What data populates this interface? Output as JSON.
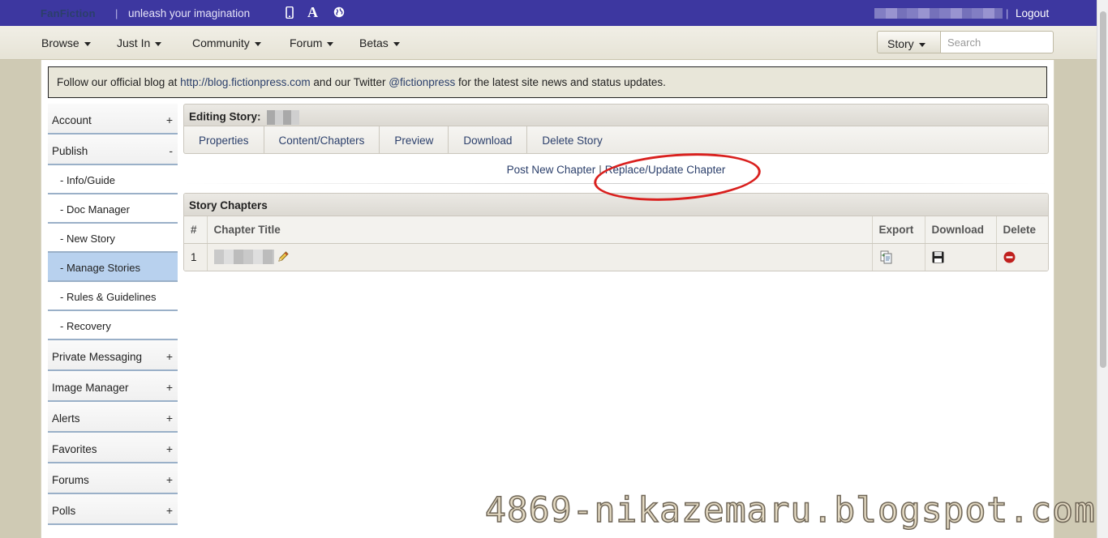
{
  "topbar": {
    "brand": "FanFiction",
    "separator": "|",
    "tagline": "unleash your imagination",
    "logout": "Logout"
  },
  "nav": {
    "items": [
      "Browse",
      "Just In",
      "Community",
      "Forum",
      "Betas"
    ],
    "story_select": "Story",
    "search_placeholder": "Search"
  },
  "notice": {
    "text_1": "Follow our official blog at ",
    "blog_link": "http://blog.fictionpress.com",
    "text_2": " and our Twitter ",
    "twitter_link": "@fictionpress",
    "text_3": " for the latest site news and status updates."
  },
  "sidebar": {
    "account": "Account",
    "publish": "Publish",
    "publish_items": [
      "- Info/Guide",
      "- Doc Manager",
      "- New Story",
      "- Manage Stories",
      "- Rules & Guidelines",
      "- Recovery"
    ],
    "more": [
      "Private Messaging",
      "Image Manager",
      "Alerts",
      "Favorites",
      "Forums",
      "Polls"
    ],
    "plus": "+",
    "minus": "-"
  },
  "main": {
    "editing_label": "Editing Story:",
    "tabs": [
      "Properties",
      "Content/Chapters",
      "Preview",
      "Download",
      "Delete Story"
    ],
    "post_new_chapter": "Post New Chapter",
    "pipe": "|",
    "replace_update_chapter": "Replace/Update Chapter",
    "chapters_title": "Story Chapters",
    "columns": [
      "#",
      "Chapter Title",
      "Export",
      "Download",
      "Delete"
    ],
    "rows": [
      {
        "num": "1"
      }
    ]
  },
  "watermark": "4869-nikazemaru.blogspot.com",
  "colors": {
    "topbar": "#3d37a0",
    "active_sidebar": "#b8d1ee",
    "annotation": "#d9201e"
  }
}
